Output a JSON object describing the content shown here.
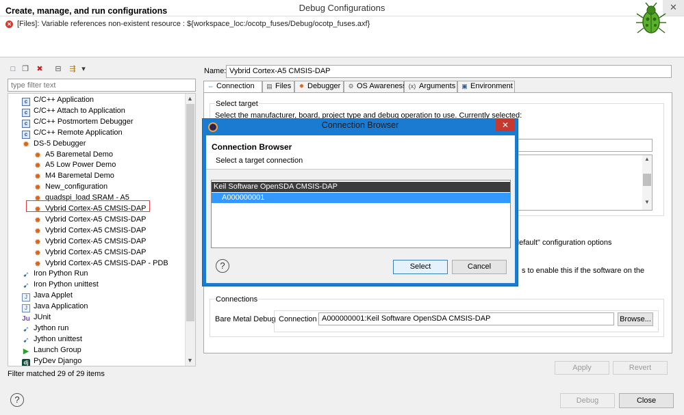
{
  "window": {
    "title": "Debug Configurations",
    "close_glyph": "✕"
  },
  "header": {
    "title": "Create, manage, and run configurations",
    "error_message": "[Files]: Variable references non-existent resource : ${workspace_loc:/ocotp_fuses/Debug/ocotp_fuses.axf}",
    "icon": "bug-icon"
  },
  "left": {
    "toolbar": [
      {
        "name": "new-config-icon",
        "glyph": "□"
      },
      {
        "name": "duplicate-icon",
        "glyph": "❐"
      },
      {
        "name": "delete-icon",
        "glyph": "✖"
      },
      {
        "name": "collapse-all-icon",
        "glyph": "⊟"
      },
      {
        "name": "filter-icon",
        "glyph": "⇶"
      },
      {
        "name": "dropdown-icon",
        "glyph": "▾"
      }
    ],
    "filter_placeholder": "type filter text",
    "tree": [
      {
        "label": "C/C++ Application",
        "icon": "c",
        "indent": 1
      },
      {
        "label": "C/C++ Attach to Application",
        "icon": "c",
        "indent": 1
      },
      {
        "label": "C/C++ Postmortem Debugger",
        "icon": "c",
        "indent": 1
      },
      {
        "label": "C/C++ Remote Application",
        "icon": "c",
        "indent": 1
      },
      {
        "label": "DS-5 Debugger",
        "icon": "ds",
        "indent": 1
      },
      {
        "label": "A5 Baremetal Demo",
        "icon": "ds",
        "indent": 2
      },
      {
        "label": "A5 Low Power Demo",
        "icon": "ds",
        "indent": 2
      },
      {
        "label": "M4 Baremetal Demo",
        "icon": "ds",
        "indent": 2
      },
      {
        "label": "New_configuration",
        "icon": "ds",
        "indent": 2
      },
      {
        "label": "quadspi_load SRAM - A5",
        "icon": "ds",
        "indent": 2
      },
      {
        "label": "Vybrid Cortex-A5 CMSIS-DAP",
        "icon": "ds",
        "indent": 2,
        "selected": true
      },
      {
        "label": "Vybrid Cortex-A5 CMSIS-DAP",
        "icon": "ds",
        "indent": 2
      },
      {
        "label": "Vybrid Cortex-A5 CMSIS-DAP",
        "icon": "ds",
        "indent": 2
      },
      {
        "label": "Vybrid Cortex-A5 CMSIS-DAP",
        "icon": "ds",
        "indent": 2
      },
      {
        "label": "Vybrid Cortex-A5 CMSIS-DAP",
        "icon": "ds",
        "indent": 2
      },
      {
        "label": "Vybrid Cortex-A5 CMSIS-DAP - PDB",
        "icon": "ds",
        "indent": 2
      },
      {
        "label": "Iron Python Run",
        "icon": "py",
        "indent": 1
      },
      {
        "label": "Iron Python unittest",
        "icon": "py",
        "indent": 1
      },
      {
        "label": "Java Applet",
        "icon": "jv",
        "indent": 1
      },
      {
        "label": "Java Application",
        "icon": "jv",
        "indent": 1
      },
      {
        "label": "JUnit",
        "icon": "ju",
        "indent": 1
      },
      {
        "label": "Jython run",
        "icon": "py",
        "indent": 1
      },
      {
        "label": "Jython unittest",
        "icon": "py",
        "indent": 1
      },
      {
        "label": "Launch Group",
        "icon": "launch",
        "indent": 1
      },
      {
        "label": "PyDev Django",
        "icon": "dj",
        "indent": 1
      }
    ],
    "status": "Filter matched 29 of 29 items"
  },
  "right": {
    "name_label": "Name:",
    "name_value": "Vybrid Cortex-A5 CMSIS-DAP",
    "tabs": [
      {
        "label": "Connection",
        "icon": "connection-icon",
        "glyph": "⇔",
        "active": true
      },
      {
        "label": "Files",
        "icon": "files-icon",
        "glyph": "▤"
      },
      {
        "label": "Debugger",
        "icon": "debugger-icon",
        "glyph": "✹"
      },
      {
        "label": "OS Awareness",
        "icon": "os-awareness-icon",
        "glyph": "⚙"
      },
      {
        "label": "Arguments",
        "icon": "arguments-icon",
        "glyph": "(x)"
      },
      {
        "label": "Environment",
        "icon": "environment-icon",
        "glyph": "▣"
      }
    ],
    "select_target": {
      "label": "Select target",
      "description": "Select the manufacturer, board, project type and debug operation to use. Currently selected:"
    },
    "default_options_text": "default\" configuration options",
    "enable_text": "s to enable this if the software on the",
    "connections": {
      "label": "Connections",
      "bare_metal_label": "Bare Metal Debug",
      "connection_label": "Connection",
      "connection_value": "A000000001:Keil Software OpenSDA CMSIS-DAP",
      "browse_label": "Browse..."
    },
    "apply_label": "Apply",
    "revert_label": "Revert"
  },
  "footer": {
    "help_glyph": "?",
    "debug_label": "Debug",
    "close_label": "Close"
  },
  "dialog": {
    "title": "Connection Browser",
    "close_glyph": "✕",
    "heading": "Connection Browser",
    "subtitle": "Select a target connection",
    "group": "Keil Software OpenSDA CMSIS-DAP",
    "item": "A000000001",
    "help_glyph": "?",
    "select_label": "Select",
    "cancel_label": "Cancel"
  }
}
